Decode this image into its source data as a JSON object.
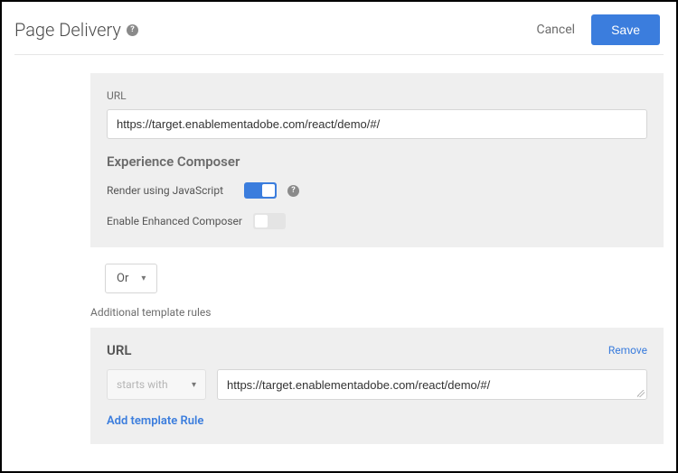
{
  "header": {
    "title": "Page Delivery",
    "cancel": "Cancel",
    "save": "Save"
  },
  "main": {
    "url_label": "URL",
    "url_value": "https://target.enablementadobe.com/react/demo/#/",
    "composer_title": "Experience Composer",
    "render_js_label": "Render using JavaScript",
    "render_js_on": true,
    "enhanced_label": "Enable Enhanced Composer",
    "enhanced_on": false
  },
  "operator": {
    "value": "Or"
  },
  "additional": {
    "heading": "Additional template rules",
    "rule_title": "URL",
    "remove": "Remove",
    "match_type": "starts with",
    "rule_value": "https://target.enablementadobe.com/react/demo/#/",
    "add_rule": "Add template Rule"
  }
}
